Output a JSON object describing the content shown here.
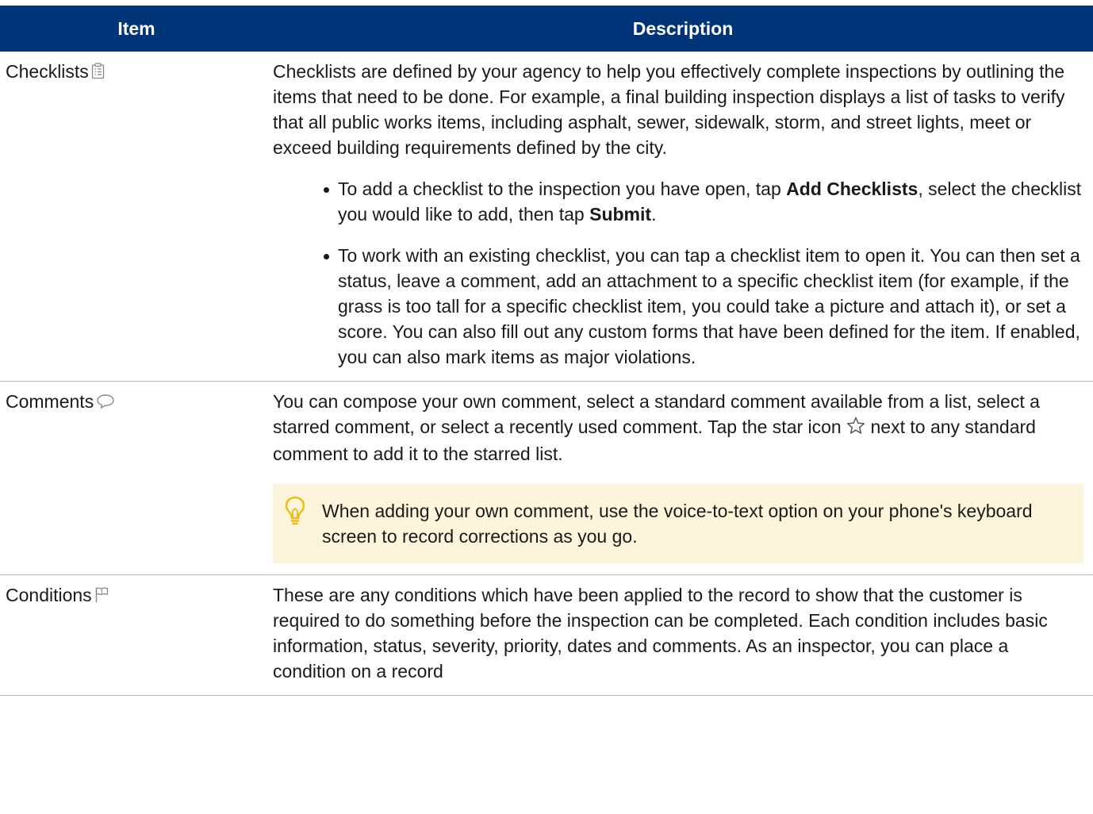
{
  "table": {
    "headers": [
      "Item",
      "Description"
    ],
    "rows": [
      {
        "item": "Checklists",
        "icon": "checklist-icon",
        "paragraph": "Checklists are defined by your agency to help you effectively complete inspections by outlining the items that need to be done. For example, a final building inspection displays a list of tasks to verify that all public works items, including asphalt, sewer, sidewalk, storm, and street lights, meet or exceed building requirements defined by the city.",
        "bullets": [
          {
            "pre": "To add a checklist to the inspection you have open, tap ",
            "bold1": "Add Checklists",
            "mid": ", select the checklist you would like to add, then tap ",
            "bold2": "Submit",
            "post": "."
          },
          {
            "text": "To work with an existing checklist, you can tap a checklist item to open it. You can then set a status, leave a comment, add an attachment to a specific checklist item (for example, if the grass is too tall for a specific checklist item, you could take a picture and attach it), or set a score. You can also fill out any custom forms that have been defined for the item. If enabled, you can also mark items as major violations."
          }
        ]
      },
      {
        "item": "Comments",
        "icon": "comment-bubble-icon",
        "paragraph_pre": "You can compose your own comment, select a standard comment available from a list, select a starred comment, or select a recently used comment. Tap the star icon ",
        "paragraph_post": " next to any standard comment to add it to the starred list.",
        "inline_icon": "star-outline-icon",
        "tip_icon": "lightbulb-icon",
        "tip": "When adding your own comment, use the voice-to-text option on your phone's keyboard screen to record corrections as you go."
      },
      {
        "item": "Conditions",
        "icon": "flag-icon",
        "paragraph": "These are any conditions which have been applied to the record to show that the customer is required to do something before the inspection can be completed. Each condition includes basic information, status, severity, priority, dates and comments. As an inspector, you can place a condition on a record"
      }
    ]
  },
  "colors": {
    "header_bg": "#003478",
    "header_text": "#ffffff",
    "tip_bg": "#fdf4dc",
    "tip_icon": "#f2b90f",
    "row_divider": "#b7b7b7"
  }
}
